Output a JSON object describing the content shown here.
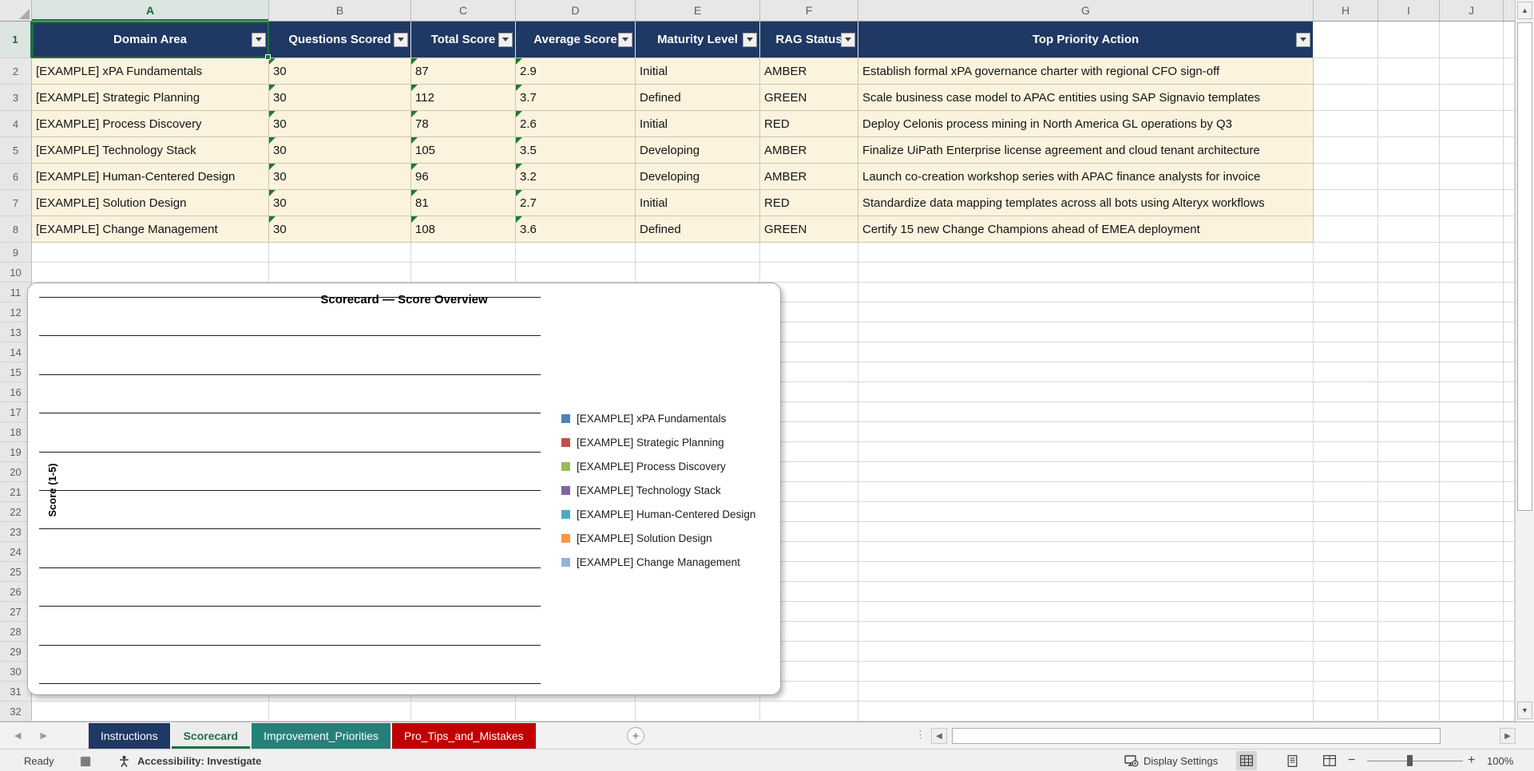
{
  "grid": {
    "column_letters": [
      "A",
      "B",
      "C",
      "D",
      "E",
      "F",
      "G",
      "H",
      "I",
      "J"
    ],
    "first_row": 1,
    "last_row": 32,
    "selected_cell": "A1"
  },
  "table": {
    "header_bg": "#1F3864",
    "row_bg": "#FBF3DE",
    "headers": [
      "Domain Area",
      "Questions Scored",
      "Total Score",
      "Average Score",
      "Maturity Level",
      "RAG Status",
      "Top Priority Action"
    ],
    "rows": [
      [
        "[EXAMPLE] xPA Fundamentals",
        "30",
        "87",
        "2.9",
        "Initial",
        "AMBER",
        "Establish formal xPA governance charter with regional CFO sign-off"
      ],
      [
        "[EXAMPLE] Strategic Planning",
        "30",
        "112",
        "3.7",
        "Defined",
        "GREEN",
        "Scale business case model to APAC entities using SAP Signavio templates"
      ],
      [
        "[EXAMPLE] Process Discovery",
        "30",
        "78",
        "2.6",
        "Initial",
        "RED",
        "Deploy Celonis process mining in North America GL operations by Q3"
      ],
      [
        "[EXAMPLE] Technology Stack",
        "30",
        "105",
        "3.5",
        "Developing",
        "AMBER",
        "Finalize UiPath Enterprise license agreement and cloud tenant architecture"
      ],
      [
        "[EXAMPLE] Human-Centered Design",
        "30",
        "96",
        "3.2",
        "Developing",
        "AMBER",
        "Launch co-creation workshop series with APAC finance analysts for invoice"
      ],
      [
        "[EXAMPLE] Solution Design",
        "30",
        "81",
        "2.7",
        "Initial",
        "RED",
        "Standardize data mapping templates across all bots using Alteryx workflows"
      ],
      [
        "[EXAMPLE] Change Management",
        "30",
        "108",
        "3.6",
        "Defined",
        "GREEN",
        "Certify 15 new Change Champions ahead of EMEA deployment"
      ]
    ],
    "error_flag_columns": [
      1,
      2,
      3
    ]
  },
  "chart_data": {
    "type": "bar",
    "title": "Scorecard — Score Overview",
    "ylabel": "Score (1-5)",
    "ylim": [
      0,
      5
    ],
    "gridline_count": 11,
    "grid": "on",
    "legend_position": "right",
    "plot_note": "plot area renders horizontal gridlines only; no data bars, axis tick labels or category labels are visible",
    "series": [
      {
        "name": "[EXAMPLE] xPA Fundamentals",
        "color": "#4F81BD"
      },
      {
        "name": "[EXAMPLE] Strategic Planning",
        "color": "#C0504D"
      },
      {
        "name": "[EXAMPLE] Process Discovery",
        "color": "#9BBB59"
      },
      {
        "name": "[EXAMPLE] Technology Stack",
        "color": "#8064A2"
      },
      {
        "name": "[EXAMPLE] Human-Centered Design",
        "color": "#4BACC6"
      },
      {
        "name": "[EXAMPLE] Solution Design",
        "color": "#F79646"
      },
      {
        "name": "[EXAMPLE] Change Management",
        "color": "#95B3D7"
      }
    ]
  },
  "sheet_tabs": {
    "tabs": [
      {
        "label": "Instructions",
        "bg": "#1F3864",
        "fg": "#FFFFFF",
        "active": false
      },
      {
        "label": "Scorecard",
        "bg": "#ECECEC",
        "fg": "#1E7145",
        "active": true
      },
      {
        "label": "Improvement_Priorities",
        "bg": "#26807A",
        "fg": "#FFFFFF",
        "active": false
      },
      {
        "label": "Pro_Tips_and_Mistakes",
        "bg": "#C00000",
        "fg": "#FFFFFF",
        "active": false
      }
    ]
  },
  "status_bar": {
    "ready": "Ready",
    "accessibility": "Accessibility: Investigate",
    "display_settings": "Display Settings",
    "zoom_percent": "100%"
  }
}
